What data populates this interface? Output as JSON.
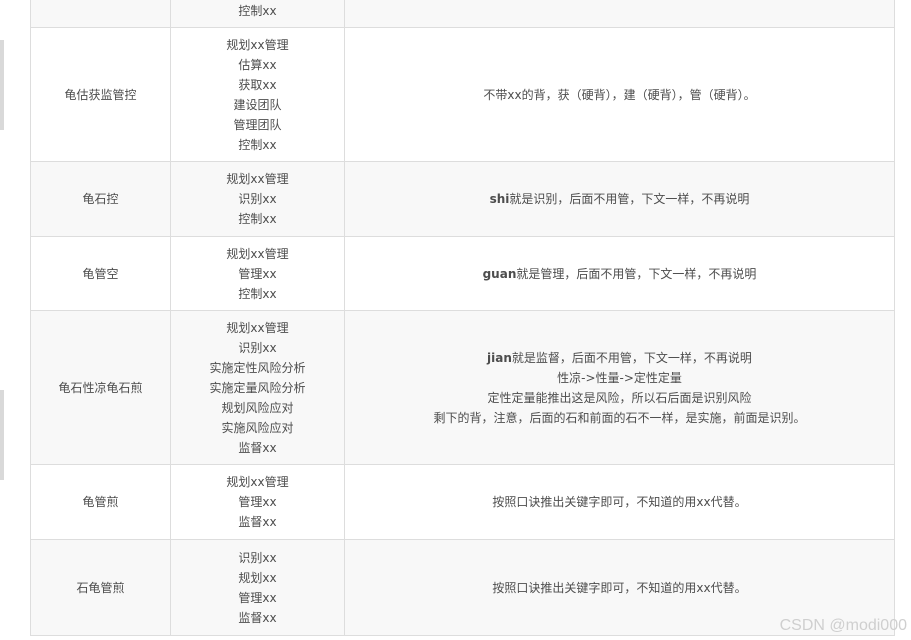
{
  "rows": [
    {
      "col1": "",
      "col2": [
        "控制xx"
      ],
      "col3": []
    },
    {
      "col1": "龟估获监管控",
      "col2": [
        "规划xx管理",
        "估算xx",
        "获取xx",
        "建设团队",
        "管理团队",
        "控制xx"
      ],
      "col3": [
        {
          "bold": "",
          "text": "不带xx的背，获（硬背），建（硬背），管（硬背）。"
        }
      ]
    },
    {
      "col1": "龟石控",
      "col2": [
        "规划xx管理",
        "识别xx",
        "控制xx"
      ],
      "col3": [
        {
          "bold": "shi",
          "text": "就是识别，后面不用管，下文一样，不再说明"
        }
      ]
    },
    {
      "col1": "龟管空",
      "col2": [
        "规划xx管理",
        "管理xx",
        "控制xx"
      ],
      "col3": [
        {
          "bold": "guan",
          "text": "就是管理，后面不用管，下文一样，不再说明"
        }
      ]
    },
    {
      "col1": "龟石性凉龟石煎",
      "col2": [
        "规划xx管理",
        "识别xx",
        "实施定性风险分析",
        "实施定量风险分析",
        "规划风险应对",
        "实施风险应对",
        "监督xx"
      ],
      "col3": [
        {
          "bold": "jian",
          "text": "就是监督，后面不用管，下文一样，不再说明"
        },
        {
          "bold": "",
          "text": "性凉->性量->定性定量"
        },
        {
          "bold": "",
          "text": "定性定量能推出这是风险，所以石后面是识别风险"
        },
        {
          "bold": "",
          "text": "剩下的背，注意，后面的石和前面的石不一样，是实施，前面是识别。"
        }
      ]
    },
    {
      "col1": "龟管煎",
      "col2": [
        "规划xx管理",
        "管理xx",
        "监督xx"
      ],
      "col3": [
        {
          "bold": "",
          "text": "按照口诀推出关键字即可，不知道的用xx代替。"
        }
      ]
    },
    {
      "col1": "石龟管煎",
      "col2": [
        "识别xx",
        "规划xx",
        "管理xx",
        "监督xx"
      ],
      "col3": [
        {
          "bold": "",
          "text": "按照口诀推出关键字即可，不知道的用xx代替。"
        }
      ]
    }
  ],
  "watermark": "CSDN @modi000",
  "colors": {
    "alt_row": "#f8f8f8",
    "border": "#dddddd",
    "text": "#4d4d4d"
  }
}
